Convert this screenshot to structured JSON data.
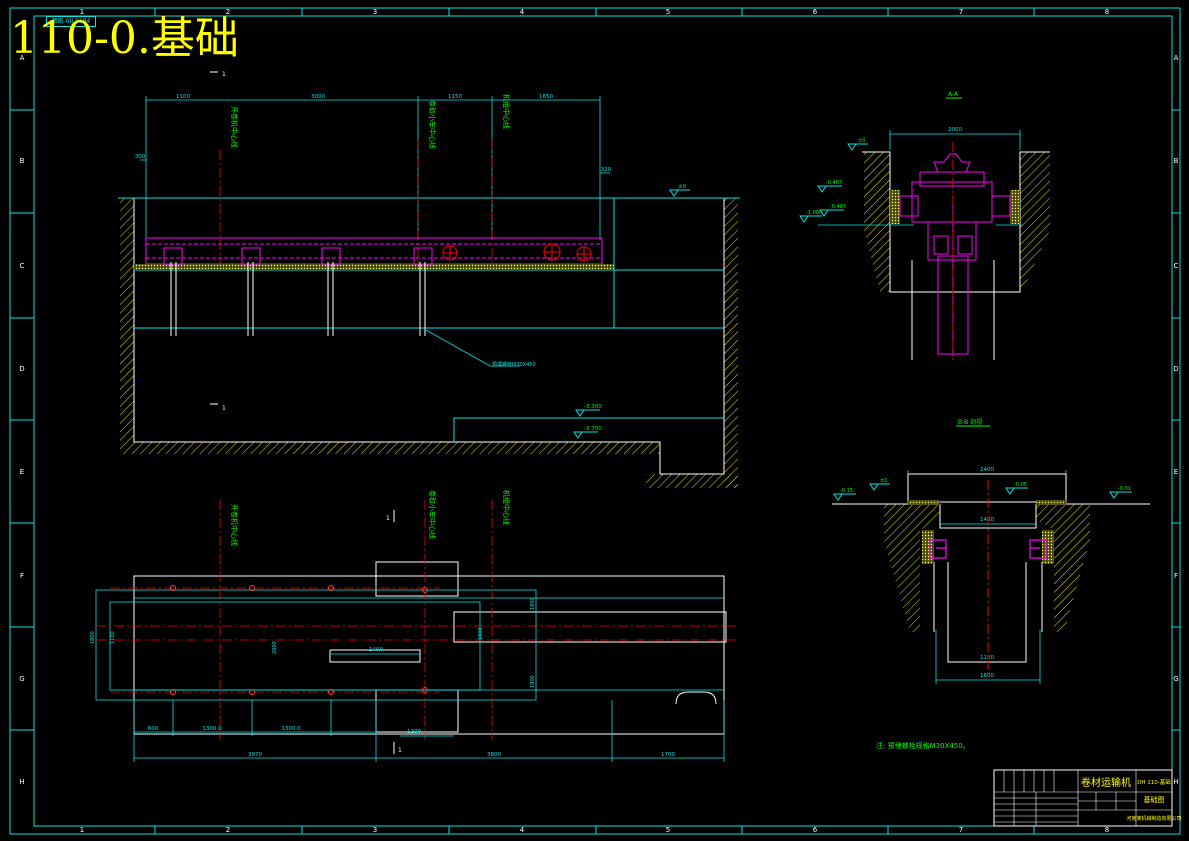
{
  "sheet": {
    "title": "110-0.基础",
    "stamp": "图纸-0II 0184",
    "grid_cols": [
      "1",
      "2",
      "3",
      "4",
      "5",
      "6",
      "7",
      "8"
    ],
    "grid_rows": [
      "A",
      "B",
      "C",
      "D",
      "E",
      "F",
      "G",
      "H"
    ]
  },
  "elevation_view": {
    "dims_top": [
      "1100",
      "3000",
      "1150",
      "1650"
    ],
    "dim_left": "300",
    "dim_right": "320",
    "elev_top": "±0",
    "elev_mid": "-3.300",
    "elev_low": "-3.700",
    "vlabels": [
      "开卷机中心线",
      "卷取小车中心线",
      "机组中心线"
    ],
    "callout": "预埋螺栓M30X450",
    "section_mark": "1"
  },
  "section_aa": {
    "title": "A-A",
    "dim_width": "2000",
    "elev_labels": [
      "±0",
      "-0.487",
      "-0.487",
      "-1.000"
    ]
  },
  "section_bb": {
    "title": "B-B 剖视",
    "dim_top": "2400",
    "dim_inner_top": "1400",
    "dim_inner_bottom": "1100",
    "dim_bottom": "1600",
    "elev_labels": [
      "-0.15",
      "±0",
      "-0.05",
      "-0.01"
    ]
  },
  "plan_view": {
    "dims_bottom_1": [
      "600",
      "1300.0",
      "1300.0"
    ],
    "dims_bottom_2": [
      "3970",
      "3800",
      "1700"
    ],
    "dim_inner": "1400",
    "dim_small": "1200",
    "dims_left": [
      "1800",
      "1100"
    ],
    "dims_mid": [
      "2000",
      "1000",
      "1800",
      "1900"
    ],
    "vlabels": [
      "开卷机中心线",
      "卷取小车中心线",
      "机组中心线"
    ],
    "section_mark": "1"
  },
  "note": "注: 预埋螺栓规格M30X450。",
  "title_block": {
    "project": "卷材运输机",
    "drawing_no": "DH 110-基础",
    "drawing_name": "基础图",
    "company": "河南某机械制造有限公司"
  },
  "colors": {
    "border": "#00e5e5",
    "steel": "#ff00ff",
    "title": "#ffff00",
    "centerline": "#ff0000",
    "label": "#00ff00",
    "hatch": "#ffff00",
    "grid_text": "#ffffff"
  }
}
